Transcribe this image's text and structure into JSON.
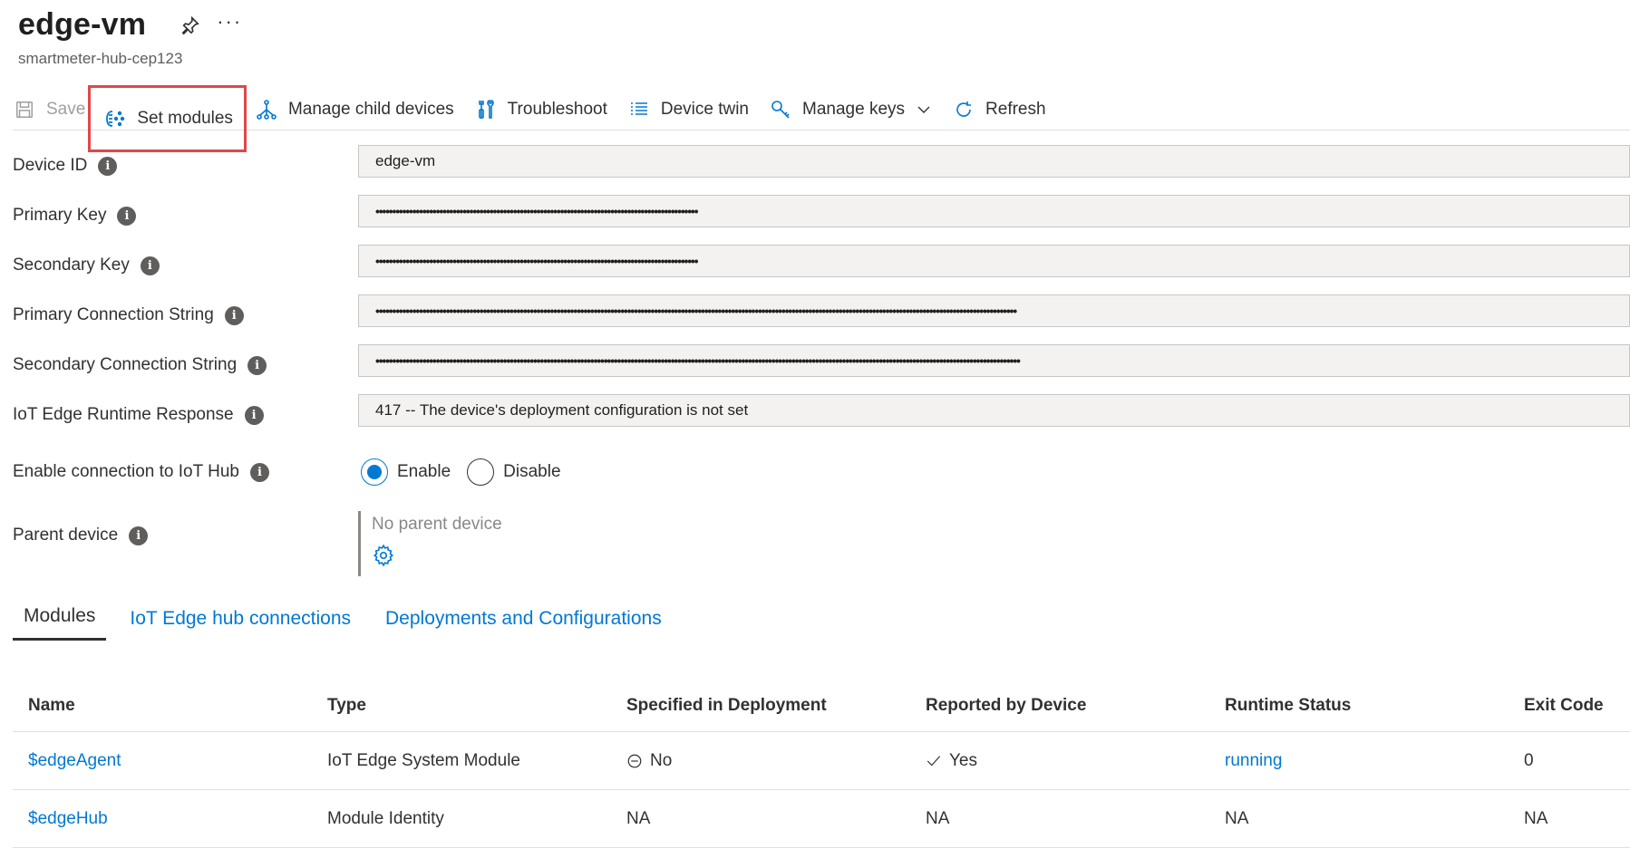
{
  "header": {
    "title": "edge-vm",
    "subtitle": "smartmeter-hub-cep123",
    "more": "···"
  },
  "toolbar": {
    "save": "Save",
    "set_modules": "Set modules",
    "manage_child": "Manage child devices",
    "troubleshoot": "Troubleshoot",
    "device_twin": "Device twin",
    "manage_keys": "Manage keys",
    "refresh": "Refresh"
  },
  "form": {
    "device_id": {
      "label": "Device ID",
      "value": "edge-vm"
    },
    "primary_key": {
      "label": "Primary Key",
      "value": "••••••••••••••••••••••••••••••••••••••••••••••••••••••••••••••••••••••••••••••••••••••••••••••••"
    },
    "secondary_key": {
      "label": "Secondary Key",
      "value": "••••••••••••••••••••••••••••••••••••••••••••••••••••••••••••••••••••••••••••••••••••••••••••••••"
    },
    "primary_conn": {
      "label": "Primary Connection String",
      "value": "•••••••••••••••••••••••••••••••••••••••••••••••••••••••••••••••••••••••••••••••••••••••••••••••••••••••••••••••••••••••••••••••••••••••••••••••••••••••••••••••••••••••••••••••••••••••••••••••"
    },
    "secondary_conn": {
      "label": "Secondary Connection String",
      "value": "••••••••••••••••••••••••••••••••••••••••••••••••••••••••••••••••••••••••••••••••••••••••••••••••••••••••••••••••••••••••••••••••••••••••••••••••••••••••••••••••••••••••••••••••••••••••••••••••"
    },
    "runtime_response": {
      "label": "IoT Edge Runtime Response",
      "value": "417 -- The device's deployment configuration is not set"
    },
    "enable_conn": {
      "label": "Enable connection to IoT Hub",
      "enable": "Enable",
      "disable": "Disable",
      "selected": "Enable"
    },
    "parent": {
      "label": "Parent device",
      "value": "No parent device"
    }
  },
  "tabs": [
    {
      "label": "Modules",
      "active": true
    },
    {
      "label": "IoT Edge hub connections",
      "active": false
    },
    {
      "label": "Deployments and Configurations",
      "active": false
    }
  ],
  "table": {
    "headers": [
      "Name",
      "Type",
      "Specified in Deployment",
      "Reported by Device",
      "Runtime Status",
      "Exit Code"
    ],
    "rows": [
      {
        "name": "$edgeAgent",
        "type": "IoT Edge System Module",
        "specified": "No",
        "reported": "Yes",
        "status": "running",
        "exit": "0"
      },
      {
        "name": "$edgeHub",
        "type": "Module Identity",
        "specified": "NA",
        "reported": "NA",
        "status": "NA",
        "exit": "NA"
      }
    ]
  },
  "colors": {
    "accent": "#0078d4",
    "highlight": "#e0474a",
    "field_bg": "#f3f2f1"
  }
}
